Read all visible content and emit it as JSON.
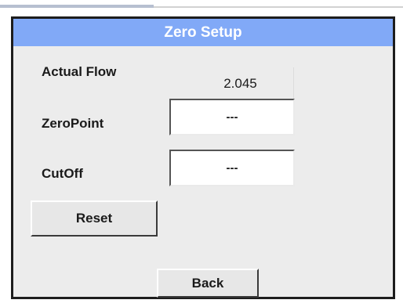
{
  "dialog": {
    "title": "Zero Setup"
  },
  "fields": {
    "actual_flow": {
      "label": "Actual Flow",
      "value": "2.045"
    },
    "zero_point": {
      "label": "ZeroPoint",
      "value": "---"
    },
    "cut_off": {
      "label": "CutOff",
      "value": "---"
    }
  },
  "buttons": {
    "reset": "Reset",
    "back": "Back"
  },
  "colors": {
    "title_bar": "#81a9f7",
    "panel_bg": "#ececec",
    "frame": "#1d1d1d"
  }
}
